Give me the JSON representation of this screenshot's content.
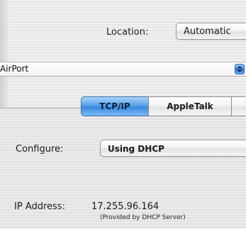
{
  "location": {
    "label": "Location:",
    "selected": "Automatic"
  },
  "show": {
    "selected": "AirPort"
  },
  "tabs": [
    {
      "label": "TCP/IP",
      "active": true
    },
    {
      "label": "AppleTalk",
      "active": false
    }
  ],
  "tcpip": {
    "configure_label": "Configure:",
    "configure_value": "Using DHCP",
    "ip_label": "IP Address:",
    "ip_value": "17.255.96.164",
    "ip_note": "(Provided by DHCP Server)"
  },
  "colors": {
    "active_tab": "#4a95e3",
    "background_light": "#f1f1f1",
    "background_stripe": "#e6e6e6"
  },
  "icons": {
    "stepper": "up-down-arrows-icon"
  }
}
